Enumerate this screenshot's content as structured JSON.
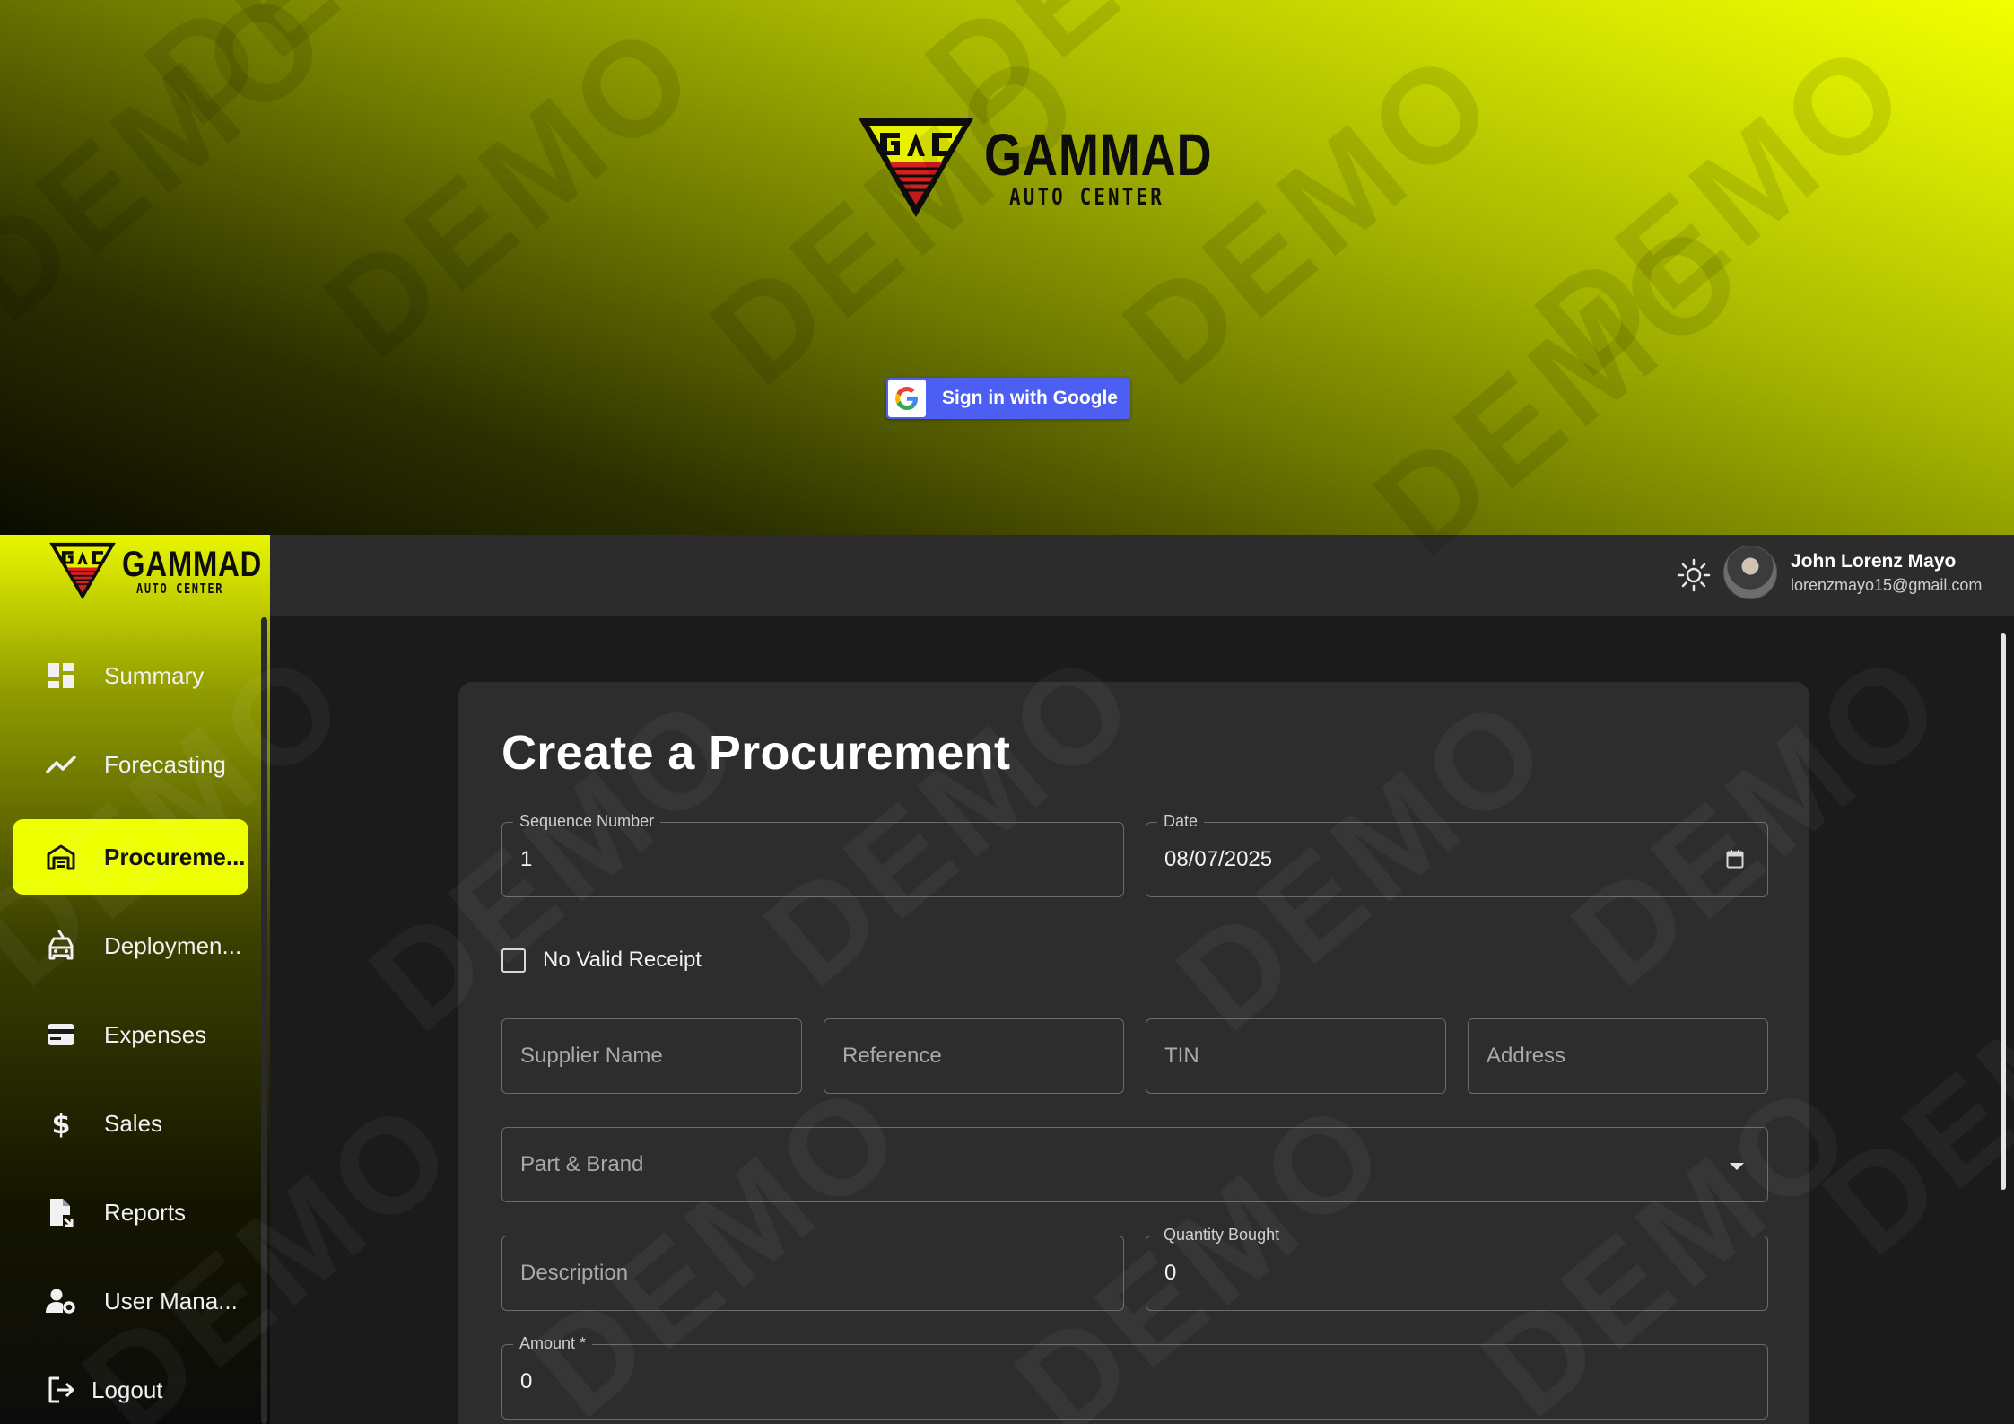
{
  "brand": {
    "name": "GAMMAD",
    "subtitle": "AUTO CENTER",
    "colors": {
      "accent": "#eeff00",
      "google_button": "#4d5ef2"
    }
  },
  "login": {
    "google_button_label": "Sign in with Google"
  },
  "sidebar": {
    "items": [
      {
        "label": "Summary",
        "icon": "dashboard-icon"
      },
      {
        "label": "Forecasting",
        "icon": "trend-line-icon"
      },
      {
        "label": "Procureme...",
        "icon": "store-icon",
        "active": true
      },
      {
        "label": "Deploymen...",
        "icon": "car-service-icon"
      },
      {
        "label": "Expenses",
        "icon": "wallet-icon"
      },
      {
        "label": "Sales",
        "icon": "dollar-icon"
      },
      {
        "label": "Reports",
        "icon": "report-document-icon"
      },
      {
        "label": "User Mana...",
        "icon": "user-settings-icon"
      }
    ],
    "logout_label": "Logout"
  },
  "topbar": {
    "user_name": "John Lorenz Mayo",
    "user_email": "lorenzmayo15@gmail.com"
  },
  "form": {
    "title": "Create a Procurement",
    "sequence": {
      "label": "Sequence Number",
      "value": "1"
    },
    "date": {
      "label": "Date",
      "value": "08/07/2025"
    },
    "no_receipt_label": "No Valid Receipt",
    "supplier_placeholder": "Supplier Name",
    "reference_placeholder": "Reference",
    "tin_placeholder": "TIN",
    "address_placeholder": "Address",
    "part_brand_placeholder": "Part & Brand",
    "description_placeholder": "Description",
    "quantity": {
      "label": "Quantity Bought",
      "value": "0"
    },
    "amount": {
      "label": "Amount *",
      "value": "0"
    }
  },
  "watermark_text": "DEMO"
}
